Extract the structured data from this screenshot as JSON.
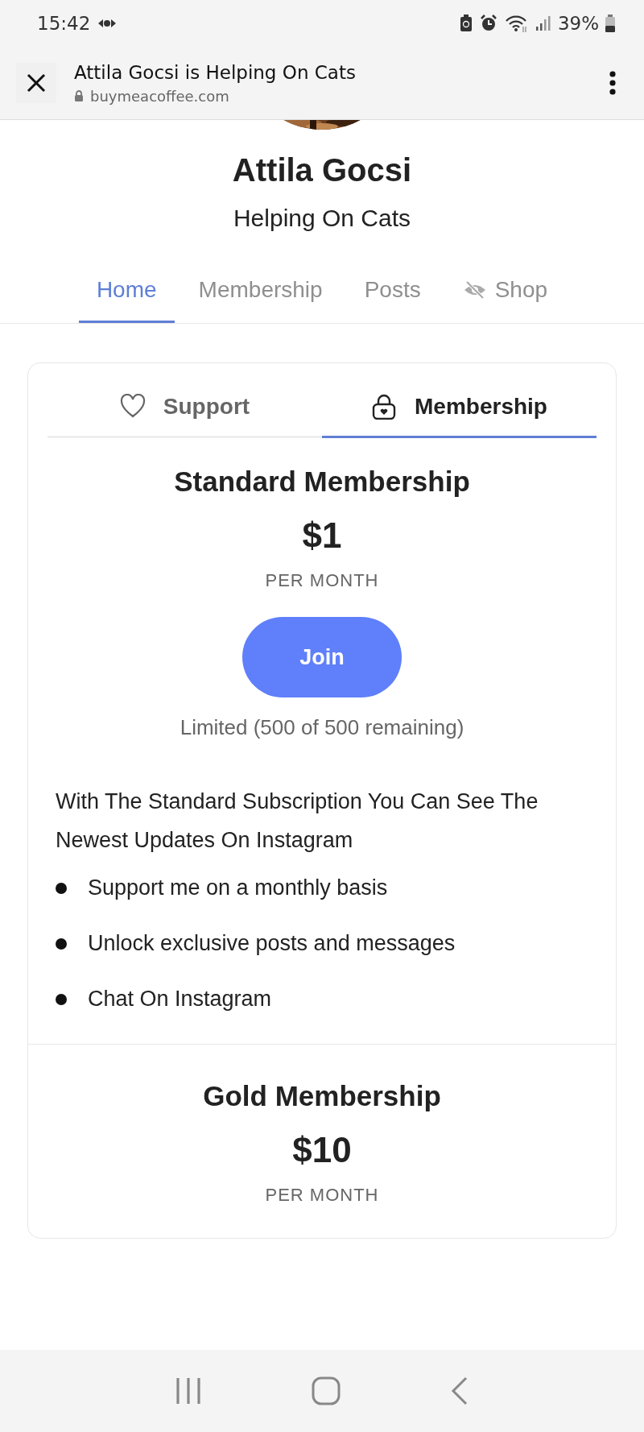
{
  "status_bar": {
    "time": "15:42",
    "battery": "39%"
  },
  "browser_bar": {
    "title": "Attila Gocsi is Helping On Cats",
    "url": "buymeacoffee.com"
  },
  "profile": {
    "name": "Attila Gocsi",
    "tagline": "Helping On Cats"
  },
  "nav_tabs": [
    {
      "label": "Home",
      "selected": true,
      "hidden": false
    },
    {
      "label": "Membership",
      "selected": false,
      "hidden": false
    },
    {
      "label": "Posts",
      "selected": false,
      "hidden": false
    },
    {
      "label": "Shop",
      "selected": false,
      "hidden": true
    }
  ],
  "card_tabs": [
    {
      "label": "Support",
      "kind": "heart",
      "selected": false
    },
    {
      "label": "Membership",
      "kind": "lock",
      "selected": true
    }
  ],
  "memberships": [
    {
      "title": "Standard Membership",
      "price": "$1",
      "period": "PER MONTH",
      "button": "Join",
      "availability": "Limited (500 of 500 remaining)",
      "description": "With The Standard Subscription You Can See The Newest Updates On Instagram",
      "perks": [
        "Support me on a monthly basis",
        "Unlock exclusive posts and messages",
        "Chat On Instagram"
      ]
    },
    {
      "title": "Gold Membership",
      "price": "$10",
      "period": "PER MONTH"
    }
  ]
}
